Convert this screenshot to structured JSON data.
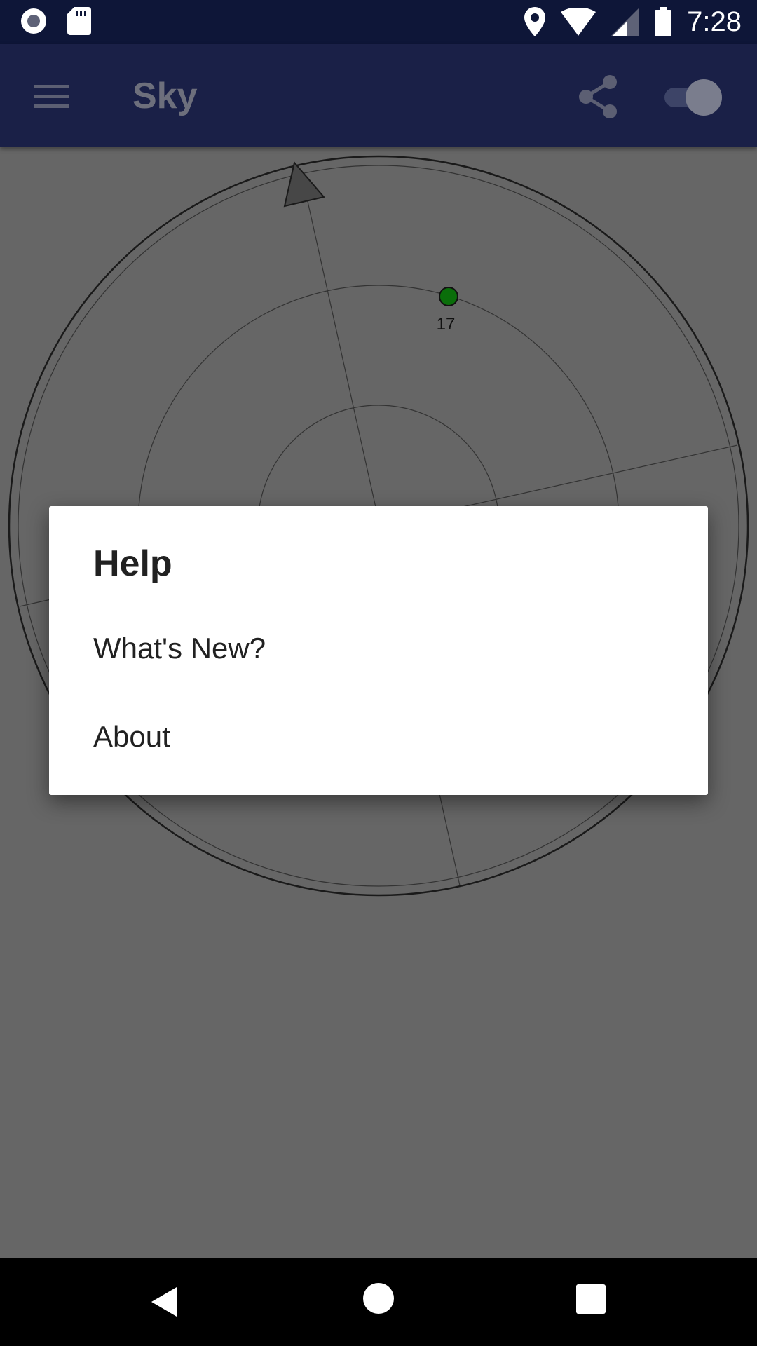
{
  "status_bar": {
    "time": "7:28",
    "icons": [
      "record-icon",
      "sd-card-icon",
      "location-icon",
      "wifi-icon",
      "signal-icon",
      "battery-icon"
    ]
  },
  "app_bar": {
    "title": "Sky",
    "icons": [
      "menu-icon",
      "share-icon"
    ],
    "toggle_on": true
  },
  "sky_plot": {
    "satellite": {
      "label": "17",
      "color": "#0a6e0a"
    }
  },
  "dialog": {
    "title": "Help",
    "items": [
      {
        "label": "What's New?"
      },
      {
        "label": "About"
      }
    ]
  },
  "colors": {
    "status_bar": "#0e1638",
    "app_bar": "#1a2047",
    "scrim_background": "#666666",
    "dialog": "#ffffff"
  }
}
